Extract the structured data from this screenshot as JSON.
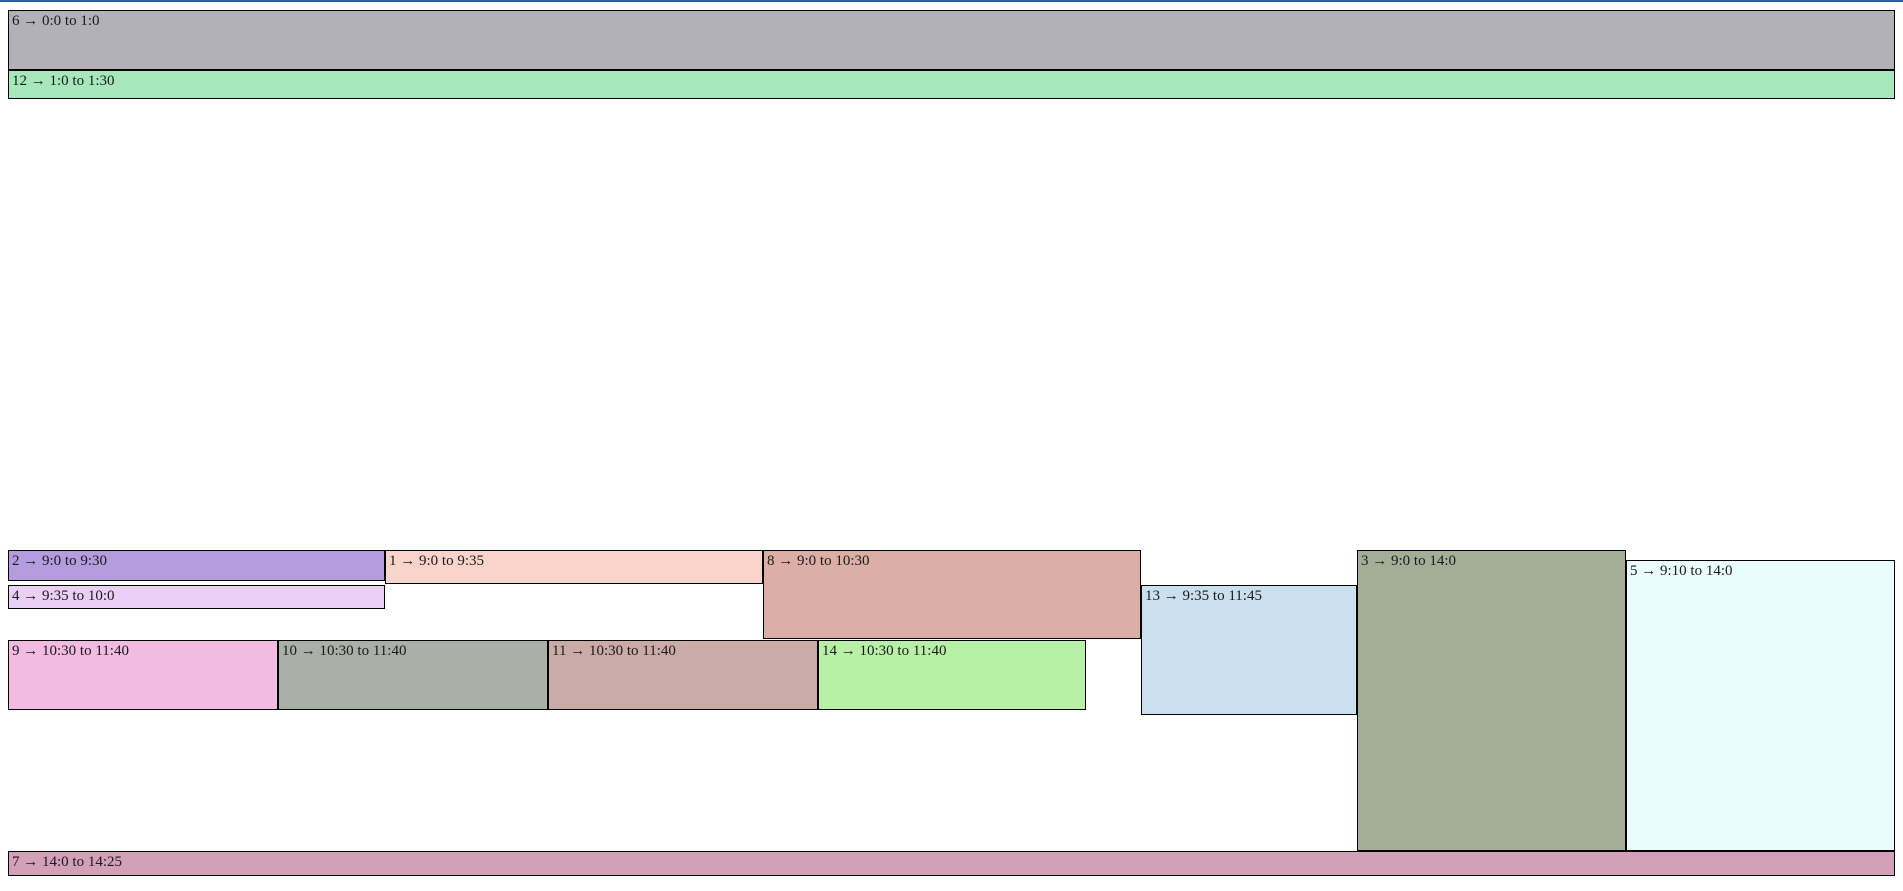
{
  "events": {
    "e6": {
      "label": "6 → 0:0 to 1:0",
      "color": "#b2b1b7"
    },
    "e12": {
      "label": "12 → 1:0 to 1:30",
      "color": "#a6e8bb"
    },
    "e2": {
      "label": "2 → 9:0 to 9:30",
      "color": "#b39ddf"
    },
    "e4": {
      "label": "4 → 9:35 to 10:0",
      "color": "#ebcff4"
    },
    "e1": {
      "label": "1 → 9:0 to 9:35",
      "color": "#f8d4ca"
    },
    "e8": {
      "label": "8 → 9:0 to 10:30",
      "color": "#dbafa5"
    },
    "e9": {
      "label": "9 → 10:30 to 11:40",
      "color": "#f3bae2"
    },
    "e10": {
      "label": "10 → 10:30 to 11:40",
      "color": "#aab0a6"
    },
    "e11": {
      "label": "11 → 10:30 to 11:40",
      "color": "#cbaba8"
    },
    "e14": {
      "label": "14 → 10:30 to 11:40",
      "color": "#b8f1a6"
    },
    "e13": {
      "label": "13 → 9:35 to 11:45",
      "color": "#cbe0ef"
    },
    "e3": {
      "label": "3 → 9:0 to 14:0",
      "color": "#a3ae99"
    },
    "e5": {
      "label": "5 → 9:10 to 14:0",
      "color": "#eafcfb"
    },
    "e7": {
      "label": "7 → 14:0 to 14:25",
      "color": "#d2a0b9"
    }
  }
}
